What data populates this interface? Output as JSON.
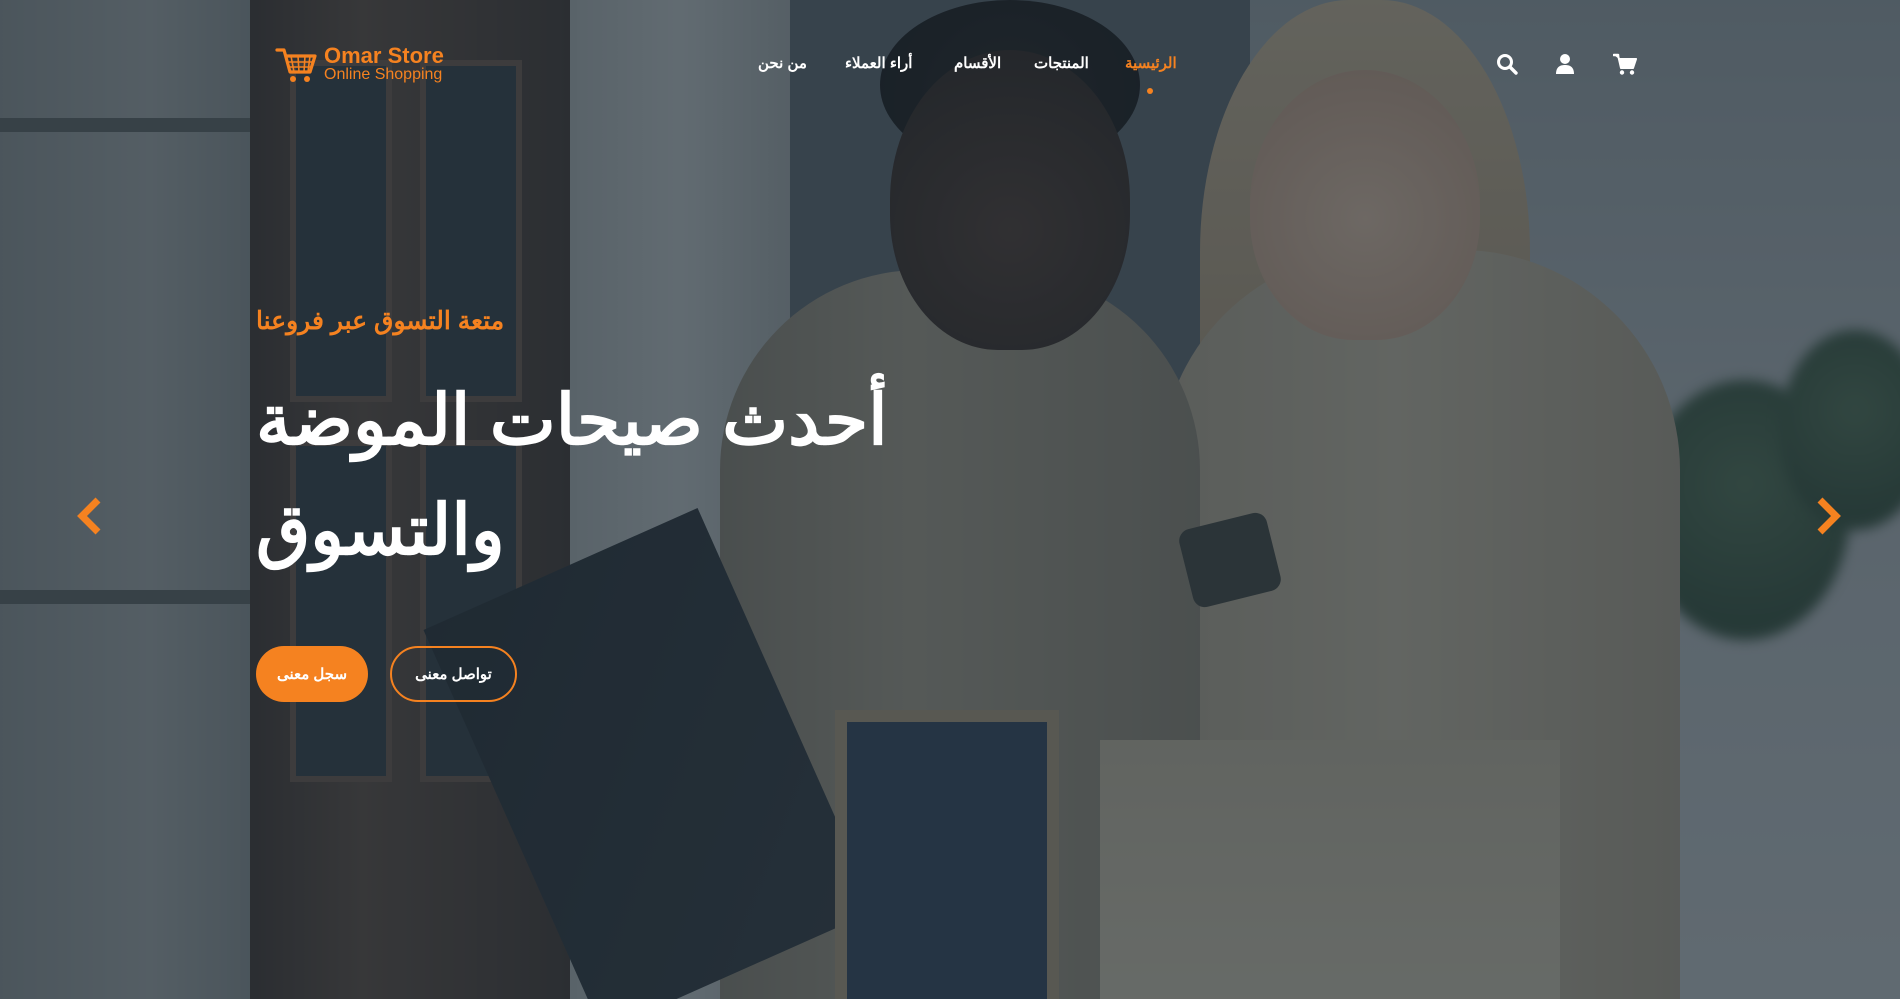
{
  "brand": {
    "name": "Omar Store",
    "tagline": "Online Shopping",
    "accent_color": "#f58220",
    "logo_icon": "shopping-cart-icon"
  },
  "nav": {
    "items": [
      {
        "label": "الرئيسية",
        "active": true
      },
      {
        "label": "المنتجات",
        "active": false
      },
      {
        "label": "الأقسام",
        "active": false
      },
      {
        "label": "أراء العملاء",
        "active": false
      },
      {
        "label": "من نحن",
        "active": false
      }
    ]
  },
  "header_icons": [
    "search-icon",
    "user-icon",
    "cart-icon"
  ],
  "hero": {
    "eyebrow": "متعة التسوق عبر فروعنا",
    "headline": "أحدث صيحات الموضة والتسوق",
    "primary_button": "سجل معنى",
    "secondary_button": "تواصل معنى"
  },
  "carousel": {
    "prev_icon": "chevron-left-icon",
    "next_icon": "chevron-right-icon"
  }
}
